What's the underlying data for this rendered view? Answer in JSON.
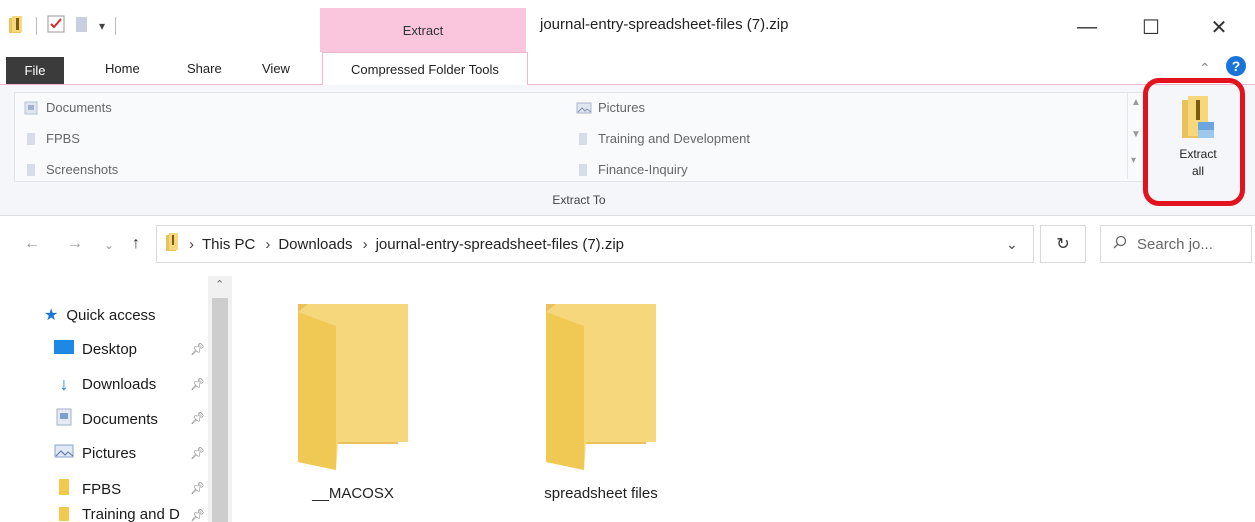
{
  "window": {
    "title": "journal-entry-spreadsheet-files (7).zip",
    "context_group_label": "Extract",
    "minimize_glyph": "—",
    "maximize_glyph": "☐",
    "close_glyph": "✕"
  },
  "ribbon": {
    "tabs": [
      "File",
      "Home",
      "Share",
      "View",
      "Compressed Folder Tools"
    ],
    "help_glyph": "?",
    "extract_to": {
      "group_label": "Extract To",
      "items_left": [
        "Documents",
        "FPBS",
        "Screenshots"
      ],
      "items_right": [
        "Pictures",
        "Training and Development",
        "Finance-Inquiry"
      ]
    },
    "extract_all": {
      "line1": "Extract",
      "line2": "all"
    }
  },
  "address": {
    "crumbs": [
      "This PC",
      "Downloads",
      "journal-entry-spreadsheet-files (7).zip"
    ],
    "search_placeholder": "Search jo..."
  },
  "nav": {
    "quick_access": "Quick access",
    "items": [
      "Desktop",
      "Downloads",
      "Documents",
      "Pictures",
      "FPBS",
      "Training and D"
    ]
  },
  "content": {
    "folders": [
      "__MACOSX",
      "spreadsheet files"
    ]
  },
  "colors": {
    "context_tab": "#f9c6de",
    "highlight_ring": "#e2131e",
    "folder_front": "#f7d77c",
    "folder_back": "#e9c25e",
    "accent_blue": "#1a73d9"
  }
}
